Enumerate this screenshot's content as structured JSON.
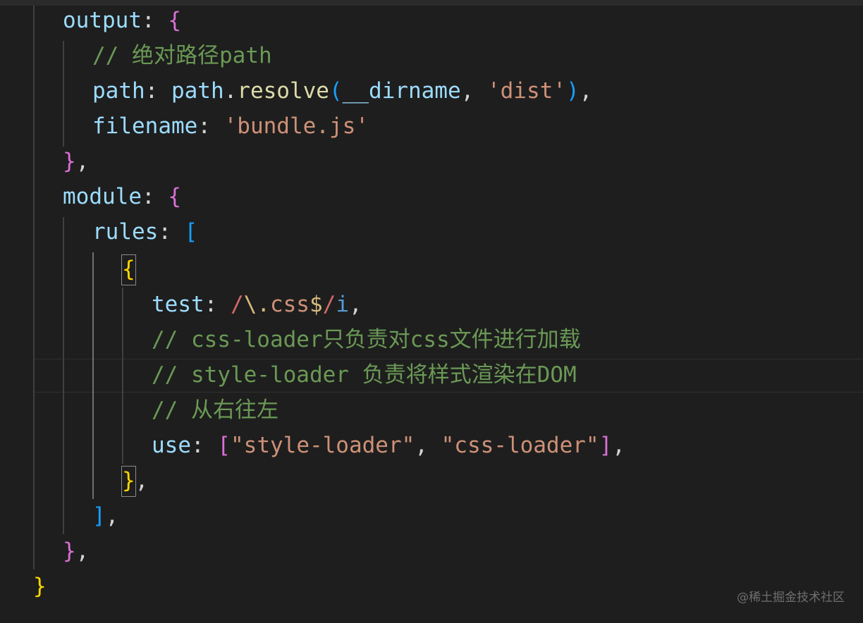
{
  "code": {
    "output_key": "output",
    "comment_abs_path": "// 绝对路径path",
    "path_key": "path",
    "path_obj": "path",
    "resolve_fn": "resolve",
    "dirname_var": "__dirname",
    "dist_str": "'dist'",
    "filename_key": "filename",
    "bundle_str": "'bundle.js'",
    "module_key": "module",
    "rules_key": "rules",
    "test_key": "test",
    "regex_slash_open": "/",
    "regex_escape": "\\.",
    "regex_body": "css",
    "regex_end": "$",
    "regex_slash_close": "/",
    "regex_flag": "i",
    "comment_css_loader": "// css-loader只负责对css文件进行加载",
    "comment_style_loader": "// style-loader 负责将样式渲染在DOM",
    "comment_order": "// 从右往左",
    "use_key": "use",
    "style_loader_str": "\"style-loader\"",
    "css_loader_str": "\"css-loader\""
  },
  "watermark": "@稀土掘金技术社区",
  "colors": {
    "background": "#1e1e1e",
    "property": "#9cdcfe",
    "comment": "#6a9955",
    "string": "#ce9178",
    "function": "#dcdcaa",
    "brace_yellow": "#ffd700",
    "brace_magenta": "#da70d6",
    "brace_blue": "#179fff"
  }
}
